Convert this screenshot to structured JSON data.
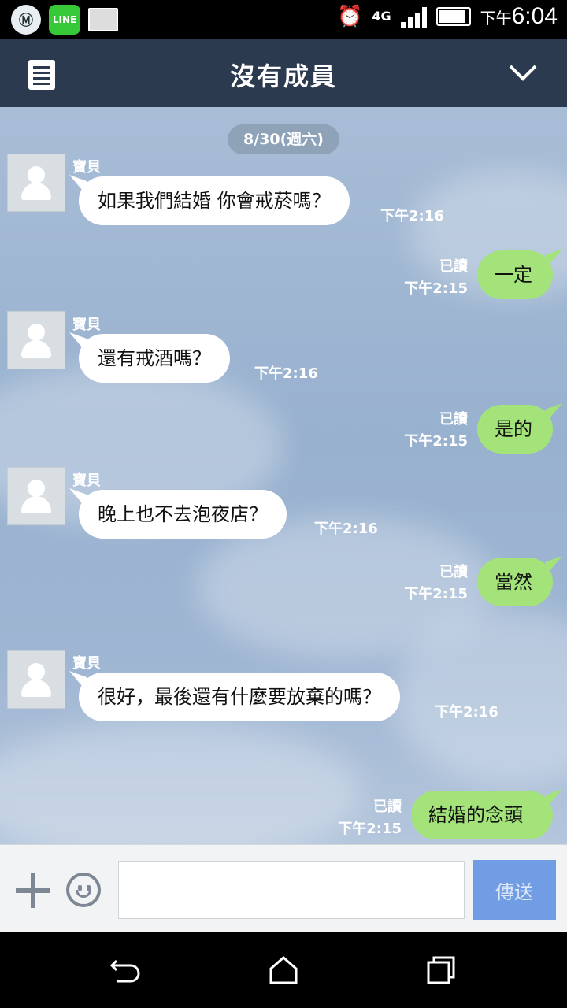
{
  "status_bar": {
    "apps": [
      "metro-icon",
      "line-icon",
      "image-icon"
    ],
    "line_label": "LINE",
    "network": "4G",
    "time_prefix": "下午",
    "time": "6:04"
  },
  "header": {
    "title": "沒有成員"
  },
  "chat": {
    "date": "8/30(週六)",
    "messages": [
      {
        "dir": "in",
        "sender": "寶貝",
        "text": "如果我們結婚 你會戒菸嗎？",
        "time": "下午2:16"
      },
      {
        "dir": "out",
        "read": "已讀",
        "text": "一定",
        "time": "下午2:15"
      },
      {
        "dir": "in",
        "sender": "寶貝",
        "text": "還有戒酒嗎？",
        "time": "下午2:16"
      },
      {
        "dir": "out",
        "read": "已讀",
        "text": "是的",
        "time": "下午2:15"
      },
      {
        "dir": "in",
        "sender": "寶貝",
        "text": "晚上也不去泡夜店？",
        "time": "下午2:16"
      },
      {
        "dir": "out",
        "read": "已讀",
        "text": "當然",
        "time": "下午2:15"
      },
      {
        "dir": "in",
        "sender": "寶貝",
        "text": "很好，最後還有什麼要放棄的嗎？",
        "time": "下午2:16"
      },
      {
        "dir": "out",
        "read": "已讀",
        "text": "結婚的念頭",
        "time": "下午2:15"
      }
    ]
  },
  "input": {
    "value": "",
    "send_label": "傳送"
  },
  "colors": {
    "header_bg": "#2c3a4f",
    "outgoing_bubble": "#a3e37a",
    "incoming_bubble": "#ffffff",
    "send_button": "#5b8fe2"
  }
}
